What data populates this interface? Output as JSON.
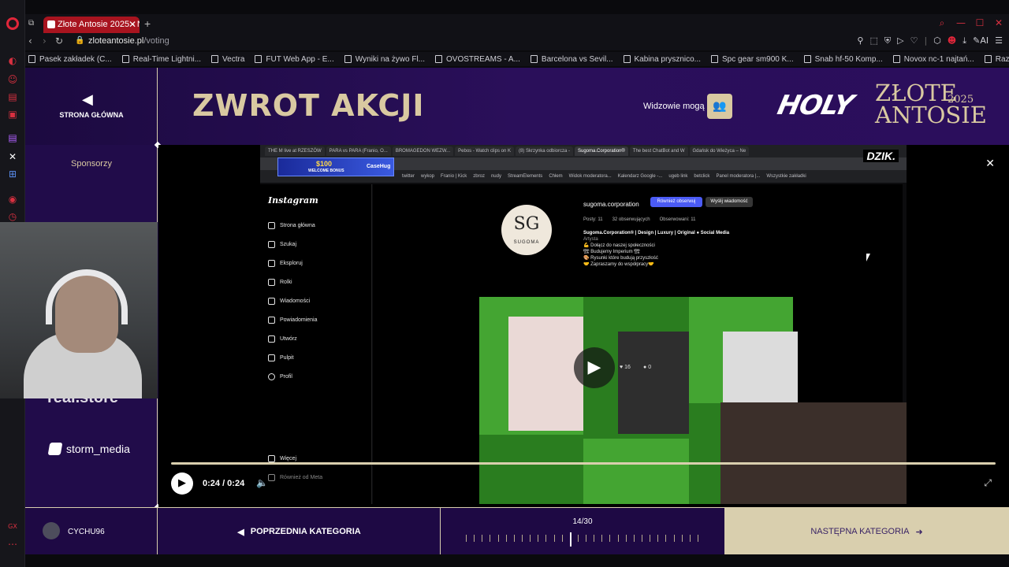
{
  "browser": {
    "tab_title": "Złote Antosie 2025 - Najw",
    "url_domain": "zloteantosie.pl",
    "url_path": "/voting",
    "bookmarks": [
      "Pasek zakładek (C...",
      "Real-Time Lightni...",
      "Vectra",
      "FUT Web App - E...",
      "Wyniki na żywo Fl...",
      "OVOSTREAMS - A...",
      "Barcelona vs Sevil...",
      "Kabina prysznico...",
      "Spc gear sm900 K...",
      "Snab hf-50 Komp...",
      "Novox nc-1 najtań...",
      "Razer Seiren X Ca..."
    ],
    "ai_label": "AI"
  },
  "header": {
    "home_label": "STRONA GŁÓWNA",
    "category_title": "ZWROT AKCJI",
    "viewers_label": "Widzowie mogą",
    "logo_holy": "HOLY",
    "logo_zlote": "ZŁOTE",
    "logo_antosie": "ANTOSIE",
    "logo_year": "2025"
  },
  "sidebar": {
    "sponsors_label": "Sponsorzy",
    "sponsor_partial": "real.store",
    "sponsor_storm": "storm_media"
  },
  "video": {
    "time": "0:24 / 0:24",
    "progress": 1.0,
    "inner": {
      "tabs": [
        "THE M live at RZESZÓW",
        "PARA vs PARA (Franio, O...",
        "BROMAGEDON WEZW...",
        "Pebos - Watch clips on K",
        "(8) Skrzynka odbiorcza -",
        "Sugoma.Corporation®",
        "The best ChatBot and W",
        "Gdańsk do Wieżyca – Ne"
      ],
      "bookmarks": [
        "twitter",
        "wykop",
        "Franio | Kick",
        "zbroz",
        "nudy",
        "StreamElements",
        "Chłem",
        "Widok moderatora...",
        "Kalendarz Google -...",
        "ugeb link",
        "betclick",
        "Panel moderatora |...",
        "Wszystkie zakładki"
      ],
      "promo_bonus": "$100",
      "promo_welcome": "WELCOME BONUS",
      "promo_brand": "CaseHug",
      "dzik": "DZIK.",
      "ig_logo": "Instagram",
      "ig_nav": [
        "Strona główna",
        "Szukaj",
        "Eksploruj",
        "Rolki",
        "Wiadomości",
        "Powiadomienia",
        "Utwórz",
        "Pulpit",
        "Profil"
      ],
      "ig_more": "Więcej",
      "ig_meta": "Również od Meta",
      "username": "sugoma.corporation",
      "follow_btn": "Również obserwuj",
      "msg_btn": "Wyślij wiadomość",
      "stats": [
        "Posty: 11",
        "32 obserwujących",
        "Obserwowani: 11"
      ],
      "bio_title": "Sugoma.Corporation® | Design | Luxury | Original ● Social Media",
      "bio_lines": [
        "Artysta",
        "💪 Dołącz do naszej społeczności",
        "🏗 Budujemy Imperium 🏗",
        "🎨 Rysunki które budują przyszłość",
        "🤝 Zapraszamy do współpracy🤝"
      ],
      "avatar_mono": "SG",
      "avatar_sub": "SUGOMA",
      "post_likes": "16",
      "post_comments": "0"
    }
  },
  "footer": {
    "username": "CYCHU96",
    "prev_label": "POPRZEDNIA KATEGORIA",
    "counter_label": "14/30",
    "current_index": 14,
    "total": 30,
    "next_label": "NASTĘPNA KATEGORIA"
  },
  "colors": {
    "accent_gold": "#d9c9a1",
    "page_purple": "#2a0f5a",
    "opera_red": "#e0263a",
    "ig_blue": "#4b5bf5"
  }
}
